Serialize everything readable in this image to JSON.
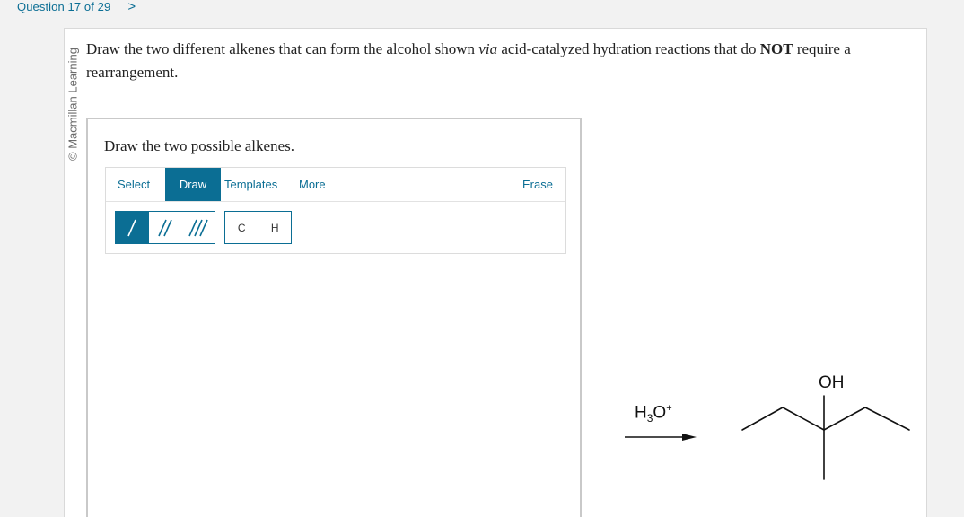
{
  "header": {
    "question_counter": "Question 17 of 29",
    "next_glyph": ">"
  },
  "sidebar": {
    "copyright": "© Macmillan Learning"
  },
  "question": {
    "text_a": "Draw the two different alkenes that can form the alcohol shown ",
    "text_via": "via",
    "text_b": " acid-catalyzed hydration reactions that do ",
    "text_not": "NOT",
    "text_c": " require a rearrangement."
  },
  "answer_panel": {
    "prompt": "Draw the two possible alkenes."
  },
  "sketcher": {
    "tabs": {
      "select": "Select",
      "draw": "Draw",
      "templates": "Templates",
      "more": "More",
      "erase": "Erase"
    },
    "active_tab": "Draw",
    "bond_tools": [
      "single-bond-icon",
      "double-bond-icon",
      "triple-bond-icon"
    ],
    "selected_bond": "single",
    "atoms": {
      "c": "C",
      "h": "H"
    }
  },
  "reaction": {
    "reagent_main": "H",
    "reagent_sub": "3",
    "reagent_o": "O",
    "reagent_sup": "+",
    "substituent": "OH"
  },
  "colors": {
    "accent": "#0b6e94",
    "card": "#ffffff",
    "page": "#f2f2f2"
  }
}
